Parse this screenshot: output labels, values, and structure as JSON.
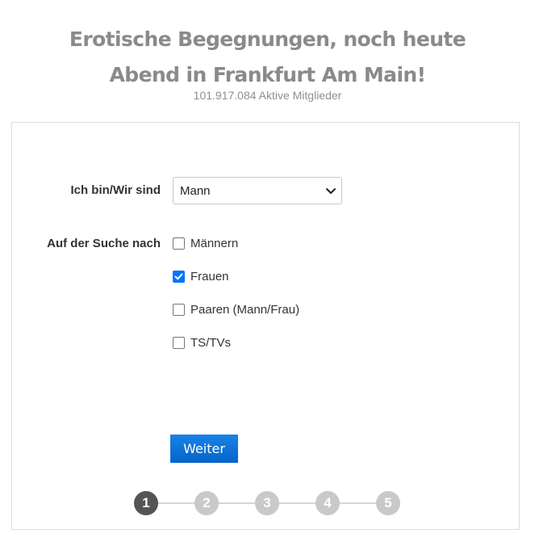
{
  "header": {
    "headline_line1": "Erotische Begegnungen, noch heute",
    "headline_line2": "Abend in Frankfurt Am Main!",
    "members": "101.917.084 Aktive Mitglieder"
  },
  "form": {
    "gender_label": "Ich bin/Wir sind",
    "gender_value": "Mann",
    "seeking_label": "Auf der Suche nach",
    "seeking_options": [
      {
        "label": "Männern",
        "checked": false
      },
      {
        "label": "Frauen",
        "checked": true
      },
      {
        "label": "Paaren (Mann/Frau)",
        "checked": false
      },
      {
        "label": "TS/TVs",
        "checked": false
      }
    ],
    "next_label": "Weiter"
  },
  "steps": {
    "items": [
      "1",
      "2",
      "3",
      "4",
      "5"
    ],
    "current": 1
  },
  "colors": {
    "accent": "#0a6fd6",
    "checkbox_checked": "#0075ff",
    "step_active": "#555555",
    "step_inactive": "#c9c9c9",
    "headline": "#8a8a8a"
  },
  "icons": {
    "select": "chevron-down-icon",
    "checked": "checkmark-icon"
  }
}
